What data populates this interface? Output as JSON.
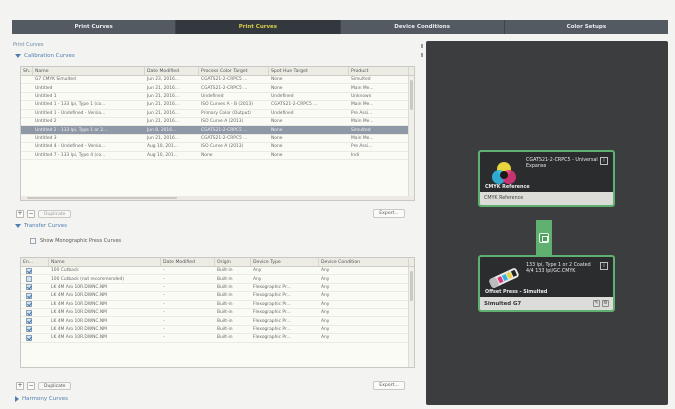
{
  "tabs": [
    {
      "label": "Print Curves",
      "active": false
    },
    {
      "label": "Print Curves",
      "active": true
    },
    {
      "label": "Device Conditions",
      "active": false
    },
    {
      "label": "Color Setups",
      "active": false
    }
  ],
  "breadcrumb": "Print Curves",
  "calibration": {
    "heading": "Calibration Curves",
    "columns": [
      "Sh...",
      "Name",
      "Date Modified",
      "Process Color Target",
      "Spot Hue Target",
      "Product"
    ],
    "rows": [
      [
        "",
        "G7 CMYK Simulted",
        "Jun 23, 2016...",
        "CGATS21-2-CRPC5 ...",
        "None",
        "Simulted"
      ],
      [
        "",
        "Untitled",
        "Jun 21, 2016...",
        "CGATS21-2-CRPC5 ...",
        "None",
        "Main Me..."
      ],
      [
        "",
        "Untitled 1",
        "Jun 21, 2016...",
        "Undefined",
        "Undefined",
        "Unknown"
      ],
      [
        "",
        "Untitled 1 - 133 lpi, Type 1 (co...",
        "Jun 21, 2016...",
        "ISO Curves A - B (2013)",
        "CGATS21-2-CRPC5 ...",
        "Main Me..."
      ],
      [
        "",
        "Untitled 1 - Undefined - Versio...",
        "Jun 21, 2016...",
        "Primary Color (Output)",
        "Undefined",
        "Pre Assi..."
      ],
      [
        "",
        "Untitled 2",
        "Jun 21, 2016...",
        "ISO Curve A (2013)",
        "None",
        "Main Me..."
      ],
      [
        "",
        "Untitled 2 - 133 lpi, Type 1 or 2...",
        "Jun 8, 2016...",
        "CGATS21-2-CRPC5 ...",
        "None",
        "Simulted"
      ],
      [
        "",
        "Untitled 3",
        "Jun 21, 2016...",
        "CGATS21-2-CRPC5 ...",
        "None",
        "Main Me..."
      ],
      [
        "",
        "Untitled 4 - Undefined - Versio...",
        "Aug 10, 201...",
        "ISO Curve A (2013)",
        "None",
        "Pre Assi..."
      ],
      [
        "",
        "Untitled 7 - 133 lpi, Type 4 (co...",
        "Aug 10, 201...",
        "None",
        "None",
        "Indi"
      ]
    ],
    "selected_index": 6,
    "duplicate_label": "Duplicate",
    "export_label": "Export..."
  },
  "transfer": {
    "heading": "Transfer Curves",
    "show_monographic_label": "Show Monographic Press Curves",
    "columns": [
      "En...",
      "Name",
      "Date Modified",
      "Origin",
      "Device Type",
      "Device Condition"
    ],
    "rows": [
      [
        "1",
        "100 Cutback",
        "-",
        "Built-in",
        "Any",
        "Any"
      ],
      [
        "0",
        "100 Cutback (not recommended)",
        "-",
        "Built-in",
        "Any",
        "Any"
      ],
      [
        "1",
        "LK 4M Aro 10R.DWNC.NM",
        "-",
        "Built-in",
        "Flexographic Pr...",
        "Any"
      ],
      [
        "1",
        "LK 4M Aro 10R.DWNC.NM",
        "-",
        "Built-in",
        "Flexographic Pr...",
        "Any"
      ],
      [
        "1",
        "LK 4M Aro 10R.DWNC.NM",
        "-",
        "Built-in",
        "Flexographic Pr...",
        "Any"
      ],
      [
        "1",
        "LK 4M Aro 10R.DWNC.NM",
        "-",
        "Built-in",
        "Flexographic Pr...",
        "Any"
      ],
      [
        "1",
        "LK 4M Aro 10R.DWNC.NM",
        "-",
        "Built-in",
        "Flexographic Pr...",
        "Any"
      ],
      [
        "1",
        "LK 4M Aro 10R.DWNC.NM",
        "-",
        "Built-in",
        "Flexographic Pr...",
        "Any"
      ],
      [
        "1",
        "LK 4M Aro 10R.DWNC.NM",
        "-",
        "Built-in",
        "Flexographic Pr...",
        "Any"
      ]
    ],
    "duplicate_label": "Duplicate",
    "export_label": "Export..."
  },
  "harmony_heading": "Harmony Curves",
  "right_panel": {
    "top_card": {
      "title": "CGATS21-2-CRPC5 - Universal Expanse",
      "subtitle": "CMYK Reference",
      "footer": "CMYK Reference"
    },
    "bottom_card": {
      "title": "133 lpi, Type 1 or 2 Coated 4/4 133 lpi/GC.CMYK",
      "subtitle": "Offset Press - Simulted",
      "footer": "Simulted G7"
    }
  },
  "colors": {
    "accent_green": "#5fb071",
    "tab_active_text": "#d8cf43",
    "selected_row": "#8e98a6",
    "panel_bg": "#3c3d3e"
  }
}
